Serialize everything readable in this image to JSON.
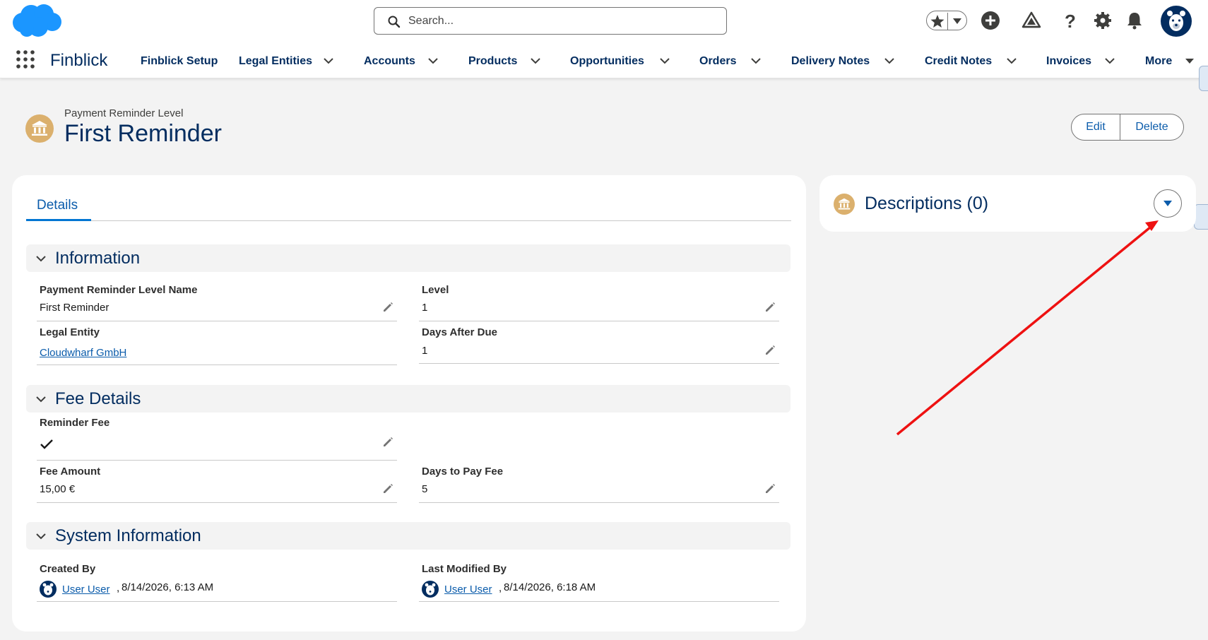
{
  "header": {
    "search_placeholder": "Search...",
    "icons": [
      "star-icon",
      "caret-down-icon",
      "add-icon",
      "trailhead-icon",
      "help-icon",
      "gear-icon",
      "bell-icon",
      "avatar"
    ]
  },
  "nav": {
    "app_name": "Finblick",
    "items": [
      {
        "label": "Finblick Setup",
        "has_menu": false
      },
      {
        "label": "Legal Entities",
        "has_menu": true
      },
      {
        "label": "Accounts",
        "has_menu": true
      },
      {
        "label": "Products",
        "has_menu": true
      },
      {
        "label": "Opportunities",
        "has_menu": true
      },
      {
        "label": "Orders",
        "has_menu": true
      },
      {
        "label": "Delivery Notes",
        "has_menu": true
      },
      {
        "label": "Credit Notes",
        "has_menu": true
      },
      {
        "label": "Invoices",
        "has_menu": true
      },
      {
        "label": "More",
        "has_menu": true
      }
    ]
  },
  "record": {
    "type": "Payment Reminder Level",
    "title": "First Reminder",
    "actions": {
      "edit": "Edit",
      "delete": "Delete"
    }
  },
  "tabs": [
    {
      "label": "Details",
      "active": true
    }
  ],
  "sections": {
    "information": {
      "title": "Information",
      "fields": {
        "name": {
          "label": "Payment Reminder Level Name",
          "value": "First Reminder"
        },
        "level": {
          "label": "Level",
          "value": "1"
        },
        "legal_entity": {
          "label": "Legal Entity",
          "value": "Cloudwharf GmbH"
        },
        "days_after_due": {
          "label": "Days After Due",
          "value": "1"
        }
      }
    },
    "fee_details": {
      "title": "Fee Details",
      "fields": {
        "reminder_fee": {
          "label": "Reminder Fee",
          "checked": true
        },
        "fee_amount": {
          "label": "Fee Amount",
          "value": "15,00 €"
        },
        "days_to_pay_fee": {
          "label": "Days to Pay Fee",
          "value": "5"
        }
      }
    },
    "system_information": {
      "title": "System Information",
      "fields": {
        "created_by": {
          "label": "Created By",
          "user": "User User",
          "sep": ",",
          "date": "8/14/2026, 6:13 AM"
        },
        "last_modified_by": {
          "label": "Last Modified By",
          "user": "User User",
          "sep": ",",
          "date": "8/14/2026, 6:18 AM"
        }
      }
    }
  },
  "side_panel": {
    "title": "Descriptions (0)"
  },
  "colors": {
    "brand": "#032d60",
    "link": "#0b5cab",
    "accent": "#0176d3",
    "record_icon": "#dbb06d",
    "annotation_arrow": "#ee1111"
  }
}
